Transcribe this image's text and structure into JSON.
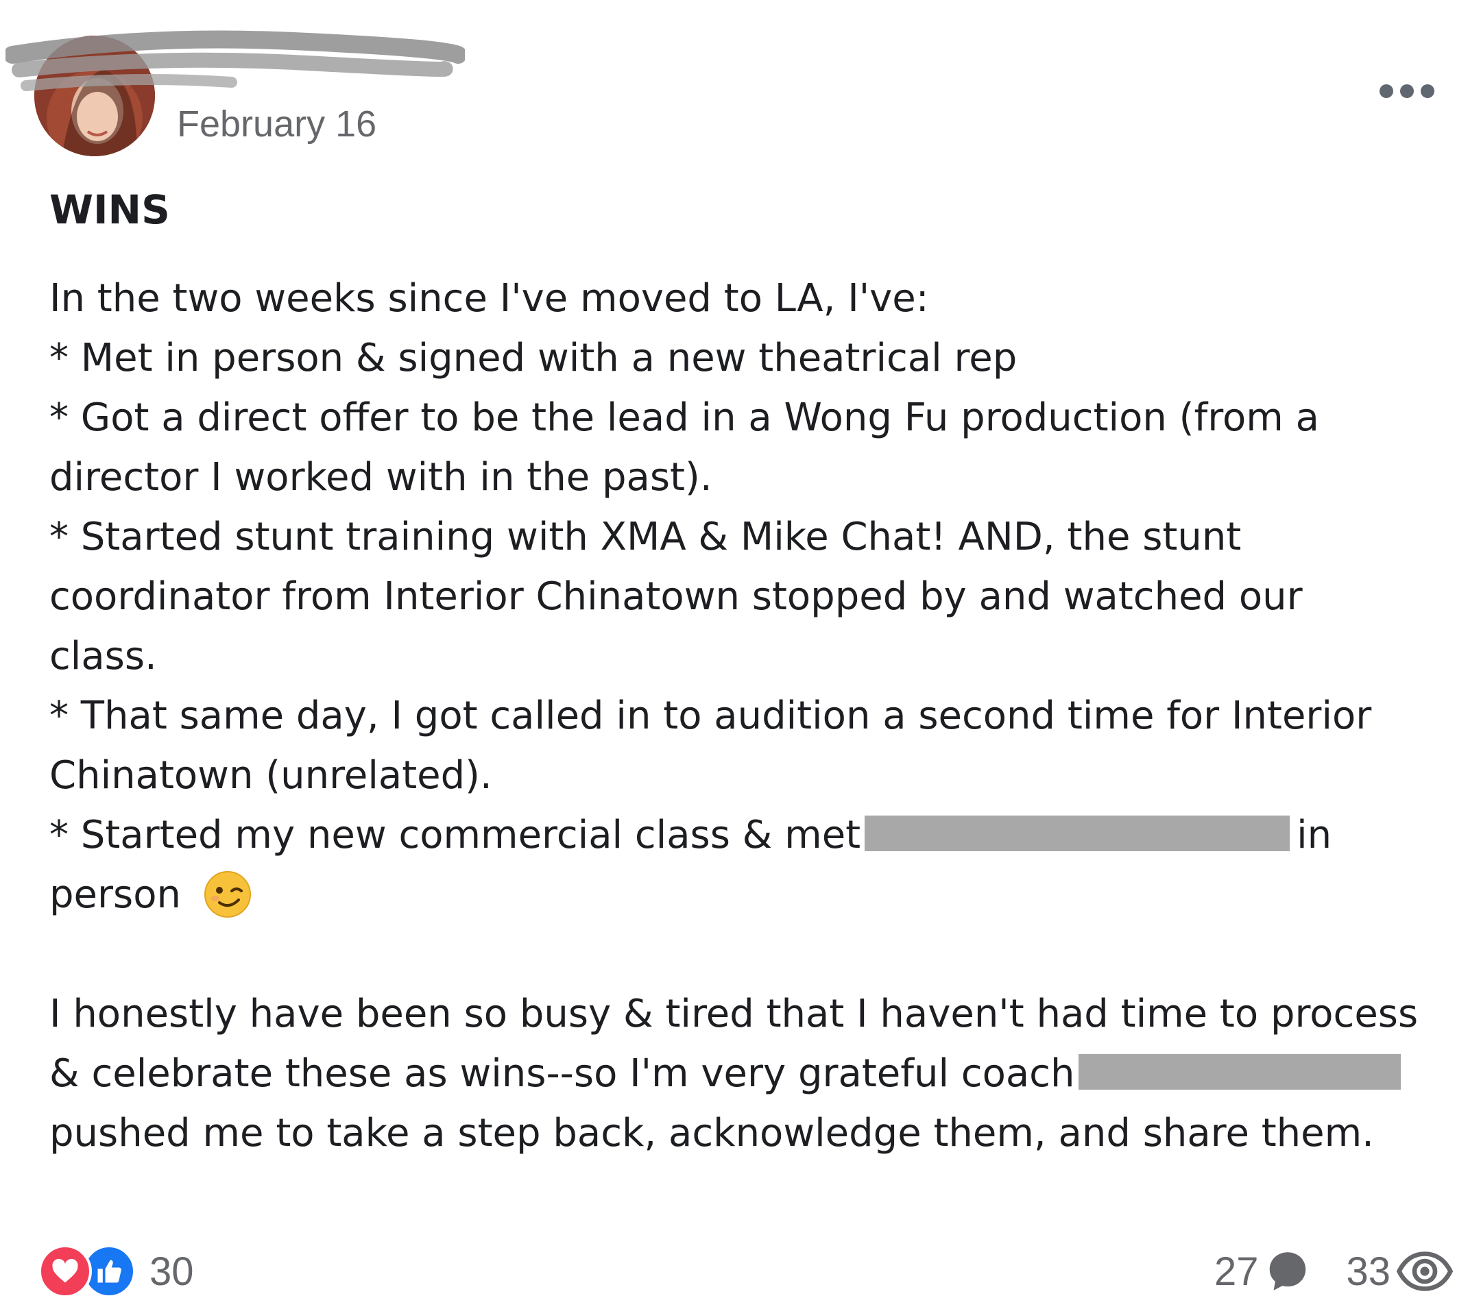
{
  "post": {
    "date": "February 16",
    "title": "WINS",
    "body": {
      "l1": "In the two weeks since I've moved to LA, I've:",
      "l2": "* Met in person & signed with a new theatrical rep",
      "l3": "* Got a direct offer to be the lead in a Wong Fu production (from a",
      "l4": "director I worked with in the past).",
      "l5": "* Started stunt training with XMA & Mike Chat! AND, the stunt",
      "l6": "coordinator from Interior Chinatown stopped by and watched our",
      "l7": "class.",
      "l8": "* That same day, I got called in to audition a second time for Interior",
      "l9": "Chinatown (unrelated).",
      "l10a": "* Started my new commercial class & met",
      "l10b": "in",
      "l11": "person",
      "l12": "I honestly have been so busy & tired that I haven't had time to process",
      "l13": "& celebrate these as wins--so I'm very grateful coach",
      "l14": "pushed me to take a step back, acknowledge them, and share them."
    }
  },
  "footer": {
    "reaction_count": "30",
    "comment_count": "27",
    "view_count": "33"
  },
  "colors": {
    "text": "#1c1e21",
    "muted": "#65676b",
    "love": "#f33e58",
    "like": "#1877f2",
    "redaction": "#a8a8a8"
  },
  "icons": [
    "more-options-icon",
    "love-reaction-icon",
    "like-reaction-icon",
    "comment-icon",
    "eye-icon",
    "winking-face-emoji"
  ]
}
